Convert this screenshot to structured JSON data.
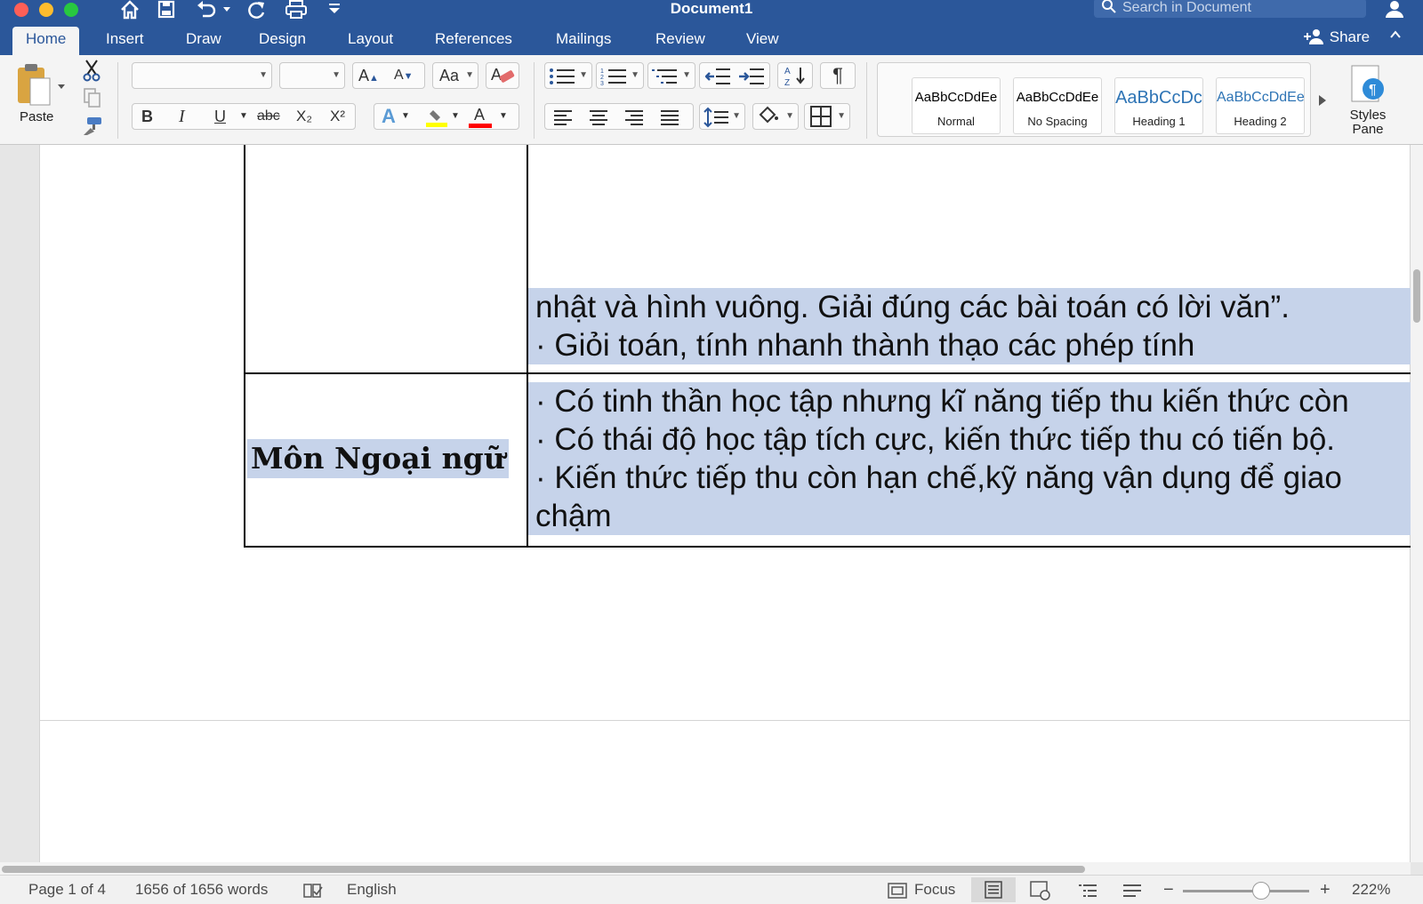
{
  "window": {
    "title": "Document1",
    "search_placeholder": "Search in Document"
  },
  "tabs": [
    "Home",
    "Insert",
    "Draw",
    "Design",
    "Layout",
    "References",
    "Mailings",
    "Review",
    "View"
  ],
  "share_label": "Share",
  "ribbon": {
    "paste_label": "Paste",
    "font_name": "",
    "font_size": "",
    "bold": "B",
    "italic": "I",
    "underline": "U",
    "strikethrough": "abc",
    "subscript": "X₂",
    "superscript": "X²",
    "styles": [
      {
        "preview": "AaBbCcDdEe",
        "name": "Normal"
      },
      {
        "preview": "AaBbCcDdEe",
        "name": "No Spacing"
      },
      {
        "preview": "AaBbCcDc",
        "name": "Heading 1"
      },
      {
        "preview": "AaBbCcDdEe",
        "name": "Heading 2"
      }
    ],
    "styles_pane_label": "Styles Pane",
    "colors": {
      "highlight": "#ffff00",
      "font_color": "#ff0000",
      "style_heading": "#2e74b5"
    }
  },
  "document": {
    "row1_lines": [
      "nhật và hình vuông. Giải đúng các bài toán có lời văn”.",
      "· Giỏi toán, tính nhanh thành thạo các phép tính"
    ],
    "row2_label": "Môn Ngoại ngữ",
    "row2_lines": [
      "· Có tinh thần học tập nhưng kĩ năng tiếp thu kiến thức còn",
      "· Có thái độ học tập tích cực, kiến thức tiếp thu có tiến bộ.",
      "· Kiến thức tiếp thu còn hạn chế,kỹ năng vận dụng để giao",
      "chậm"
    ],
    "selection_color": "#c6d3ea"
  },
  "status": {
    "page": "Page 1 of 4",
    "words": "1656 of 1656 words",
    "language": "English",
    "focus": "Focus",
    "zoom": "222%"
  }
}
